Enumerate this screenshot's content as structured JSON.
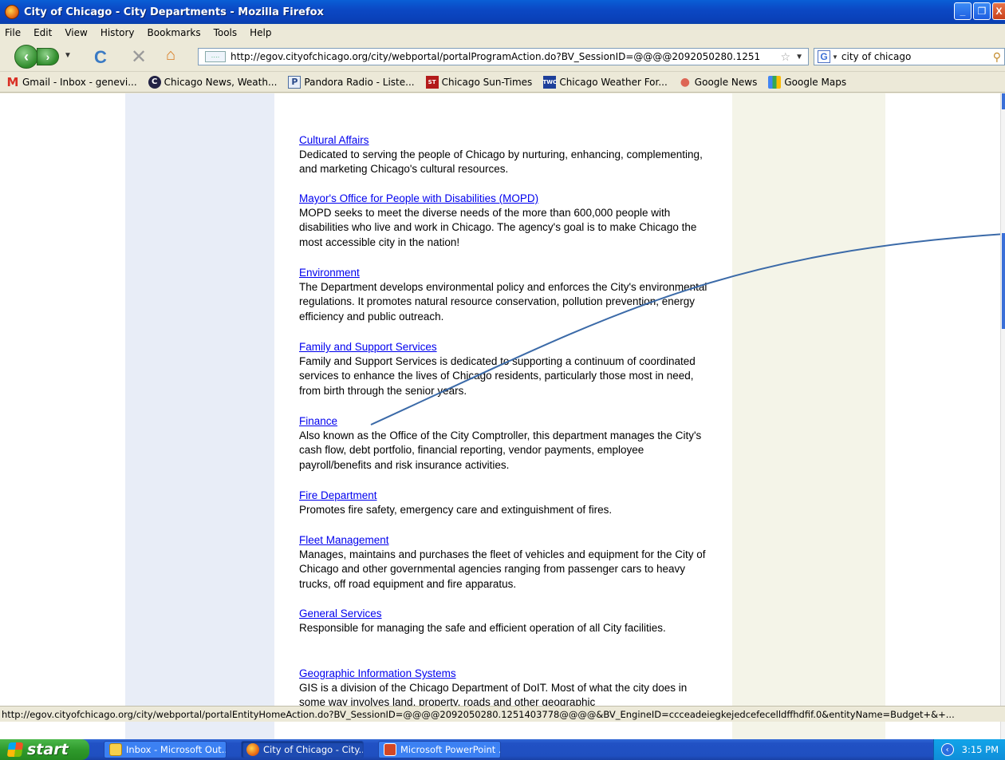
{
  "window": {
    "title": "City of Chicago - City Departments - Mozilla Firefox",
    "buttons": [
      "_",
      "❐",
      "X"
    ]
  },
  "menu": [
    "File",
    "Edit",
    "View",
    "History",
    "Bookmarks",
    "Tools",
    "Help"
  ],
  "navbar": {
    "url": "http://egov.cityofchicago.org/city/webportal/portalProgramAction.do?BV_SessionID=@@@@2092050280.1251",
    "search_engine": "G",
    "search_text": "city of chicago"
  },
  "bookmarks": [
    {
      "label": "Gmail - Inbox - genevi...",
      "icon": "gmail-icon",
      "glyph": "M"
    },
    {
      "label": "Chicago News, Weath...",
      "icon": "news-icon",
      "glyph": "C"
    },
    {
      "label": "Pandora Radio - Liste...",
      "icon": "pandora-icon",
      "glyph": "P"
    },
    {
      "label": "Chicago Sun-Times",
      "icon": "suntimes-icon",
      "glyph": "ST"
    },
    {
      "label": "Chicago Weather For...",
      "icon": "twc-icon",
      "glyph": "TWC"
    },
    {
      "label": "Google News",
      "icon": "google-news-icon",
      "glyph": "●"
    },
    {
      "label": "Google Maps",
      "icon": "google-maps-icon",
      "glyph": ""
    }
  ],
  "departments": [
    {
      "name": "Cultural Affairs",
      "description": "Dedicated to serving the people of Chicago by nurturing, enhancing, complementing, and marketing Chicago's cultural resources."
    },
    {
      "name": "Mayor's Office for People with Disabilities (MOPD)",
      "description": "MOPD seeks to meet the diverse needs of the more than 600,000 people with disabilities who live and work in Chicago. The agency's goal is to make Chicago the most accessible city in the nation!"
    },
    {
      "name": "Environment",
      "description": "The Department develops environmental policy and enforces the City's environmental regulations. It promotes natural resource conservation, pollution prevention, energy efficiency and public outreach."
    },
    {
      "name": "Family and Support Services",
      "description": "Family and Support Services is dedicated to supporting a continuum of coordinated services to enhance the lives of Chicago residents, particularly those most in need, from birth through the senior years."
    },
    {
      "name": "Finance",
      "description": "Also known as the Office of the City Comptroller, this department manages the City's cash flow, debt portfolio, financial reporting, vendor payments, employee payroll/benefits and risk insurance activities."
    },
    {
      "name": "Fire Department",
      "description": "Promotes fire safety, emergency care and extinguishment of fires."
    },
    {
      "name": "Fleet Management",
      "description": "Manages, maintains and purchases the fleet of vehicles and equipment for the City of Chicago and other governmental agencies ranging from passenger cars to heavy trucks, off road equipment and fire apparatus."
    },
    {
      "name": "General Services",
      "description": "Responsible for managing the safe and efficient operation of all City facilities."
    },
    {
      "name": "Geographic Information Systems",
      "description": "GIS is a division of the Chicago Department of DoIT. Most of what the city does in some way involves land, property, roads and other geographic"
    }
  ],
  "status": "http://egov.cityofchicago.org/city/webportal/portalEntityHomeAction.do?BV_SessionID=@@@@2092050280.1251403778@@@@&BV_EngineID=ccceadeiegkejedcefecelldffhdfif.0&entityName=Budget+&+...",
  "taskbar": {
    "start": "start",
    "tasks": [
      {
        "label": "Inbox - Microsoft Out...",
        "icon": "outlook-icon"
      },
      {
        "label": "City of Chicago - City...",
        "icon": "firefox-icon"
      },
      {
        "label": "Microsoft PowerPoint ...",
        "icon": "powerpoint-icon"
      }
    ],
    "clock": "3:15 PM"
  },
  "colors": {
    "link": "#0000ee",
    "annotation_line": "#3b6aa8",
    "left_column": "#e8edf7",
    "right_column": "#f4f4e8"
  }
}
